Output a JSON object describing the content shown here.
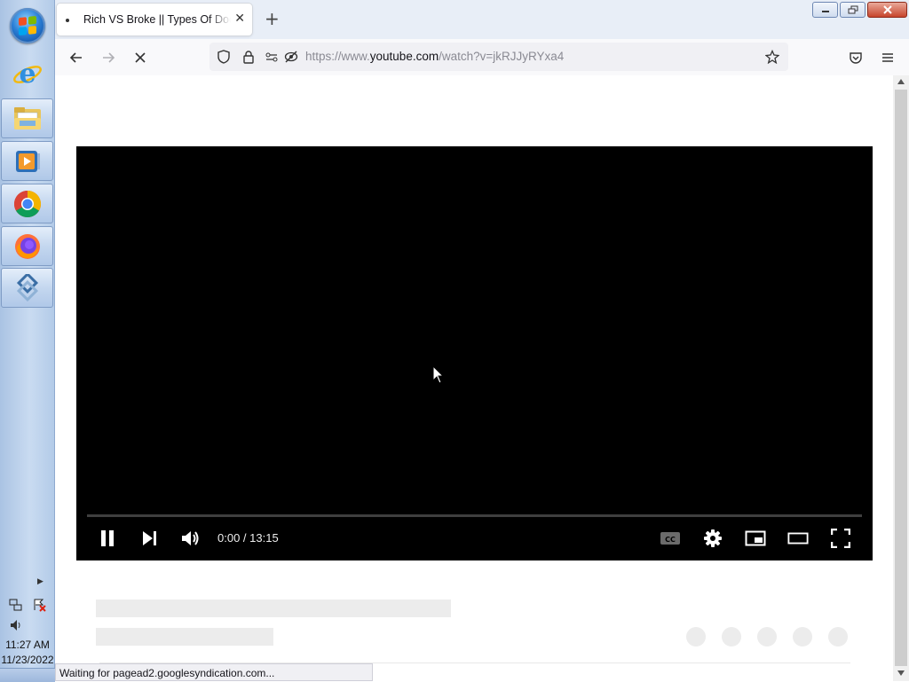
{
  "taskbar": {
    "apps": [
      {
        "name": "internet-explorer"
      },
      {
        "name": "file-explorer"
      },
      {
        "name": "media-player"
      },
      {
        "name": "chrome"
      },
      {
        "name": "firefox"
      },
      {
        "name": "remote-desktop"
      }
    ],
    "clock": {
      "time": "11:27 AM",
      "date": "11/23/2022"
    }
  },
  "browser": {
    "tab": {
      "title": "Rich VS Broke || Types Of Doodles"
    },
    "url": {
      "prefix": "https://www.",
      "domain": "youtube.com",
      "path": "/watch?v=jkRJJyRYxa4"
    },
    "status": "Waiting for pagead2.googlesyndication.com..."
  },
  "player": {
    "time_display": "0:00 / 13:15",
    "progress": 0
  },
  "colors": {
    "accent": "#0060df",
    "player_bg": "#000000",
    "skeleton": "#ececec"
  }
}
